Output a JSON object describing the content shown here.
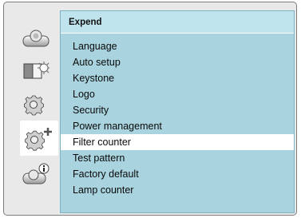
{
  "panel": {
    "title": "Expend"
  },
  "menu": {
    "items": [
      {
        "label": "Language",
        "selected": false
      },
      {
        "label": "Auto setup",
        "selected": false
      },
      {
        "label": "Keystone",
        "selected": false
      },
      {
        "label": "Logo",
        "selected": false
      },
      {
        "label": "Security",
        "selected": false
      },
      {
        "label": "Power management",
        "selected": false
      },
      {
        "label": "Filter counter",
        "selected": true
      },
      {
        "label": "Test pattern",
        "selected": false
      },
      {
        "label": "Factory default",
        "selected": false
      },
      {
        "label": "Lamp counter",
        "selected": false
      }
    ]
  },
  "sidebar": {
    "icons": [
      {
        "name": "display-icon",
        "selected": false
      },
      {
        "name": "image-adjust-icon",
        "selected": false
      },
      {
        "name": "setting-icon",
        "selected": false
      },
      {
        "name": "expand-icon",
        "selected": true
      },
      {
        "name": "info-icon",
        "selected": false
      }
    ]
  },
  "colors": {
    "panel_bg": "#a9d3df",
    "title_bg": "#bfe4ee",
    "highlight": "#ffffff",
    "frame_bg": "#e9e9e9"
  }
}
